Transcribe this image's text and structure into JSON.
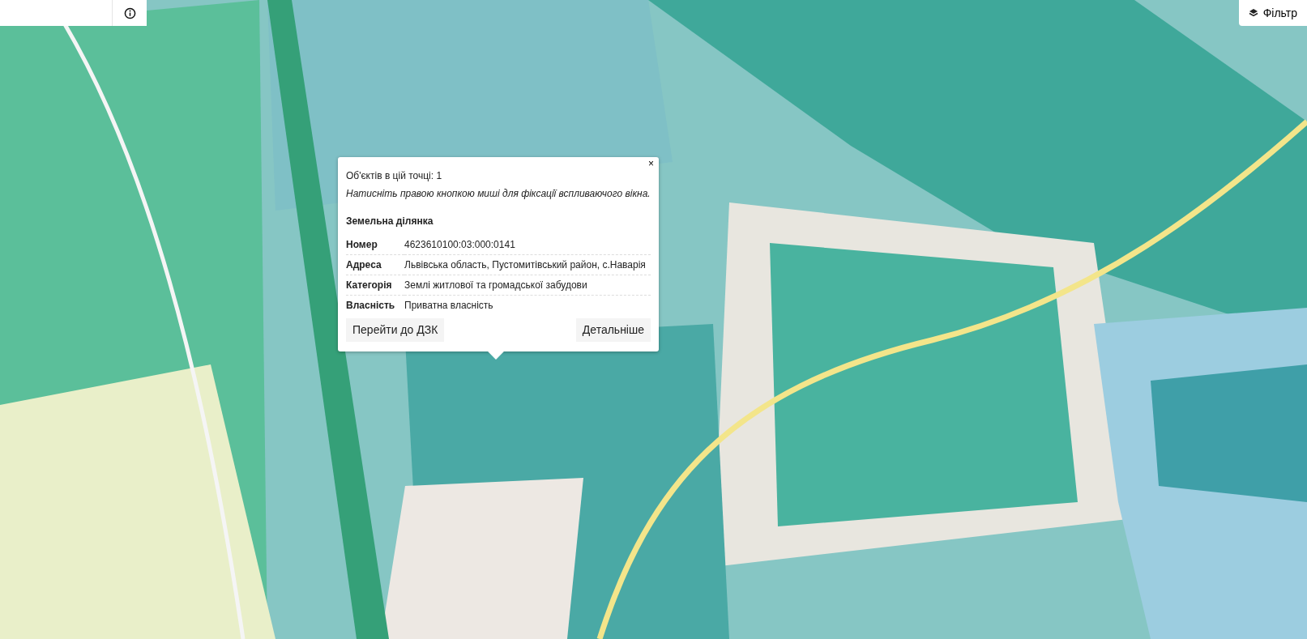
{
  "filter_button": {
    "label": "Фільтр"
  },
  "popup": {
    "close": "×",
    "count_text": "Об'єктів в цій точці: 1",
    "hint": "Натисніть правою кнопкою миші для фіксації вспливаючого вікна.",
    "section_title": "Земельна ділянка",
    "rows": [
      {
        "label": "Номер",
        "value": "4623610100:03:000:0141"
      },
      {
        "label": "Адреса",
        "value": "Львівська область, Пустомитівський район, с.Наварія"
      },
      {
        "label": "Категорія",
        "value": "Землі житлової та громадської забудови"
      },
      {
        "label": "Власність",
        "value": "Приватна власність"
      }
    ],
    "buttons": [
      "Перейти до ДЗК",
      "Детальніше"
    ]
  }
}
